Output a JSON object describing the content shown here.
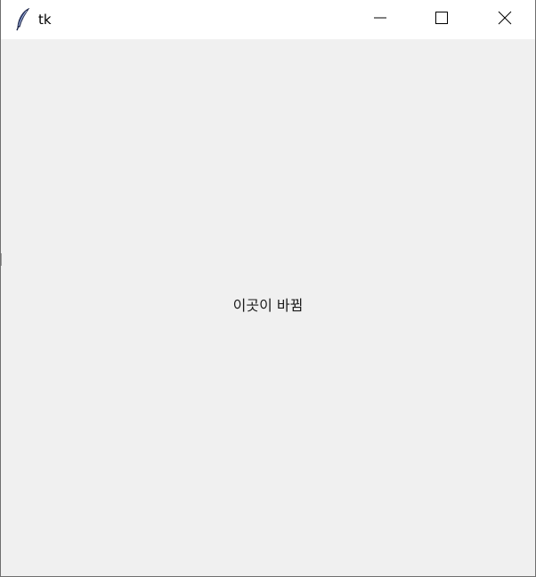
{
  "window": {
    "title": "tk",
    "icon": "feather-icon",
    "controls": [
      "minimize-icon",
      "maximize-icon",
      "close-icon"
    ]
  },
  "content": {
    "label_text": "이곳이 바뀜"
  },
  "colors": {
    "titlebar_bg": "#ffffff",
    "content_bg": "#f0f0f0",
    "text": "#1a1a1a"
  }
}
